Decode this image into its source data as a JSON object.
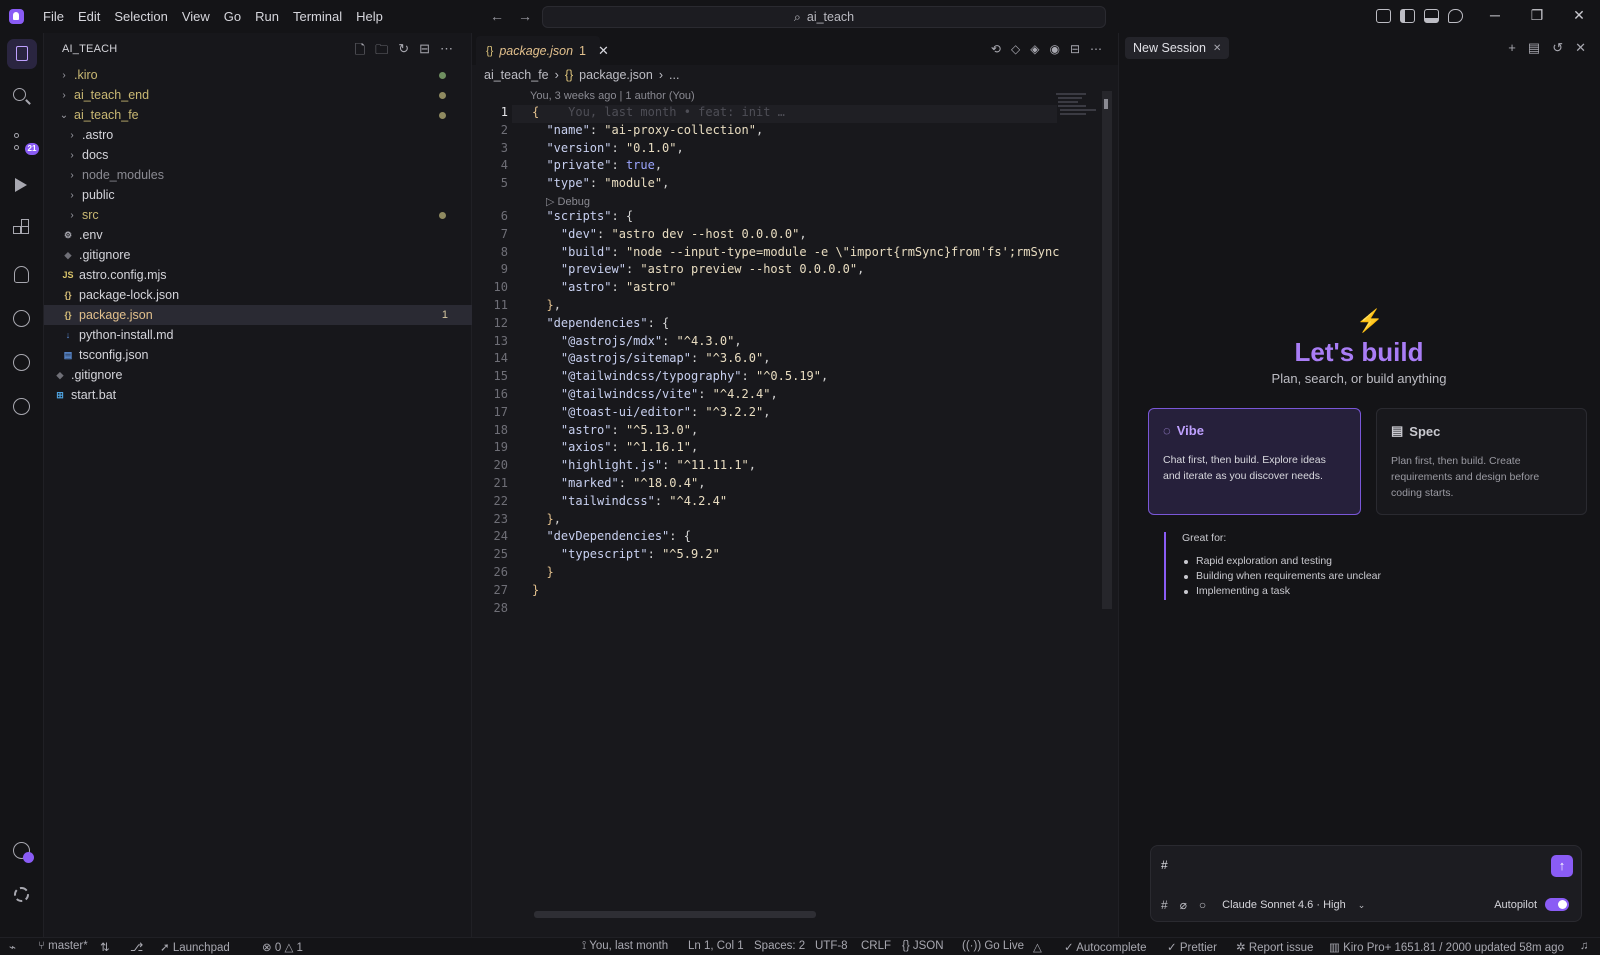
{
  "titlebar": {
    "menu": [
      "File",
      "Edit",
      "Selection",
      "View",
      "Go",
      "Run",
      "Terminal",
      "Help"
    ],
    "search": "ai_teach"
  },
  "activity": {
    "scm_badge": "21"
  },
  "explorer": {
    "title": "AI_TEACH",
    "items": [
      {
        "label": ".kiro",
        "kind": "folder"
      },
      {
        "label": "ai_teach_end",
        "kind": "folder"
      },
      {
        "label": "ai_teach_fe",
        "kind": "folder-open"
      },
      {
        "label": ".astro",
        "kind": "folder"
      },
      {
        "label": "docs",
        "kind": "folder"
      },
      {
        "label": "node_modules",
        "kind": "folder"
      },
      {
        "label": "public",
        "kind": "folder"
      },
      {
        "label": "src",
        "kind": "folder"
      },
      {
        "label": ".env",
        "kind": "file"
      },
      {
        "label": ".gitignore",
        "kind": "file"
      },
      {
        "label": "astro.config.mjs",
        "kind": "file"
      },
      {
        "label": "package-lock.json",
        "kind": "file"
      },
      {
        "label": "package.json",
        "kind": "file",
        "count": "1"
      },
      {
        "label": "python-install.md",
        "kind": "file"
      },
      {
        "label": "tsconfig.json",
        "kind": "file"
      },
      {
        "label": ".gitignore",
        "kind": "file"
      },
      {
        "label": "start.bat",
        "kind": "file"
      }
    ]
  },
  "editor": {
    "tab": {
      "name": "package.json",
      "problems": "1"
    },
    "breadcrumb": [
      "ai_teach_fe",
      "package.json",
      "..."
    ],
    "blame_header": "You, 3 weeks ago | 1 author (You)",
    "inline_blame": "You, last month • feat: init …",
    "codelens": "Debug",
    "lines": [
      "{",
      "  \"name\": \"ai-proxy-collection\",",
      "  \"version\": \"0.1.0\",",
      "  \"private\": true,",
      "  \"type\": \"module\",",
      "  \"scripts\": {",
      "    \"dev\": \"astro dev --host 0.0.0.0\",",
      "    \"build\": \"node --input-type=module -e \\\"import{rmSync}from'fs';rmSync",
      "    \"preview\": \"astro preview --host 0.0.0.0\",",
      "    \"astro\": \"astro\"",
      "  },",
      "  \"dependencies\": {",
      "    \"@astrojs/mdx\": \"^4.3.0\",",
      "    \"@astrojs/sitemap\": \"^3.6.0\",",
      "    \"@tailwindcss/typography\": \"^0.5.19\",",
      "    \"@tailwindcss/vite\": \"^4.2.4\",",
      "    \"@toast-ui/editor\": \"^3.2.2\",",
      "    \"astro\": \"^5.13.0\",",
      "    \"axios\": \"^1.16.1\",",
      "    \"highlight.js\": \"^11.11.1\",",
      "    \"marked\": \"^18.0.4\",",
      "    \"tailwindcss\": \"^4.2.4\"",
      "  },",
      "  \"devDependencies\": {",
      "    \"typescript\": \"^5.9.2\"",
      "  }",
      "}",
      ""
    ]
  },
  "chat": {
    "tab": "New Session",
    "title": "Let's build",
    "subtitle": "Plan, search, or build anything",
    "vibe": {
      "title": "Vibe",
      "desc": "Chat first, then build. Explore ideas and iterate as you discover needs."
    },
    "spec": {
      "title": "Spec",
      "desc": "Plan first, then build. Create requirements and design before coding starts."
    },
    "great_for": "Great for:",
    "great_items": [
      "Rapid exploration and testing",
      "Building when requirements are unclear",
      "Implementing a task"
    ],
    "input_value": "#",
    "model": "Claude Sonnet 4.6 · High",
    "autopilot": "Autopilot"
  },
  "status": {
    "branch": "master*",
    "launchpad": "Launchpad",
    "errors": "0",
    "warnings": "1",
    "blame": "You, last month",
    "position": "Ln 1, Col 1",
    "spaces": "Spaces: 2",
    "encoding": "UTF-8",
    "eol": "CRLF",
    "language": "JSON",
    "golive": "Go Live",
    "autocomplete": "Autocomplete",
    "prettier": "Prettier",
    "report": "Report issue",
    "usage": "Kiro Pro+ 1651.81 / 2000 updated 58m ago"
  },
  "colors": {
    "accent": "#8a5cf5",
    "accent_text": "#a97df5"
  }
}
